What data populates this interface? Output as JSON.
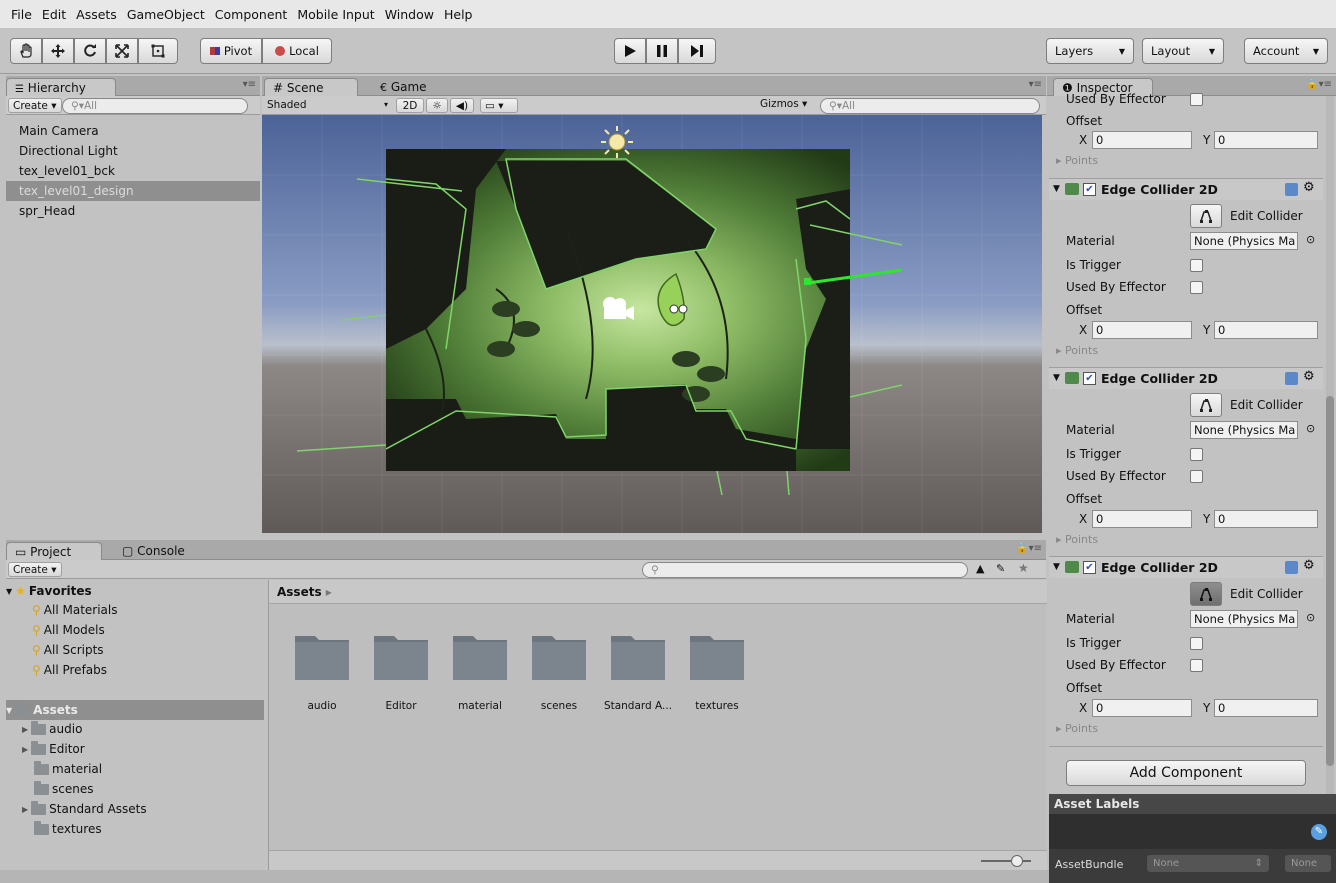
{
  "menu": [
    "File",
    "Edit",
    "Assets",
    "GameObject",
    "Component",
    "Mobile Input",
    "Window",
    "Help"
  ],
  "toolbar": {
    "pivot": "Pivot",
    "local": "Local",
    "layers": "Layers",
    "layout": "Layout",
    "account": "Account"
  },
  "hierarchy": {
    "tab": "Hierarchy",
    "create": "Create",
    "search_placeholder": "All",
    "items": [
      "Main Camera",
      "Directional Light",
      "tex_level01_bck",
      "tex_level01_design",
      "spr_Head"
    ],
    "selected_index": 3
  },
  "scene": {
    "tab_scene": "Scene",
    "tab_game": "Game",
    "shading": "Shaded",
    "mode_2d": "2D",
    "gizmos": "Gizmos",
    "search_placeholder": "All"
  },
  "inspector": {
    "tab": "Inspector",
    "top_used_by_effector": "Used By Effector",
    "top_offset": "Offset",
    "top_x": "0",
    "top_y": "0",
    "top_points": "Points",
    "components": [
      {
        "title": "Edge Collider 2D",
        "edit": "Edit Collider",
        "material_label": "Material",
        "material_value": "None (Physics Ma",
        "trigger": "Is Trigger",
        "effector": "Used By Effector",
        "offset": "Offset",
        "x": "0",
        "y": "0",
        "points": "Points"
      },
      {
        "title": "Edge Collider 2D",
        "edit": "Edit Collider",
        "material_label": "Material",
        "material_value": "None (Physics Ma",
        "trigger": "Is Trigger",
        "effector": "Used By Effector",
        "offset": "Offset",
        "x": "0",
        "y": "0",
        "points": "Points"
      },
      {
        "title": "Edge Collider 2D",
        "edit": "Edit Collider",
        "material_label": "Material",
        "material_value": "None (Physics Ma",
        "trigger": "Is Trigger",
        "effector": "Used By Effector",
        "offset": "Offset",
        "x": "0",
        "y": "0",
        "points": "Points"
      }
    ],
    "add_component": "Add Component",
    "asset_labels": "Asset Labels",
    "asset_bundle": "AssetBundle",
    "bundle_value": "None",
    "bundle_variant": "None"
  },
  "project": {
    "tab_project": "Project",
    "tab_console": "Console",
    "create": "Create",
    "favorites": "Favorites",
    "fav_items": [
      "All Materials",
      "All Models",
      "All Scripts",
      "All Prefabs"
    ],
    "assets_root": "Assets",
    "asset_tree": [
      "audio",
      "Editor",
      "material",
      "scenes",
      "Standard Assets",
      "textures"
    ],
    "breadcrumb": "Assets",
    "folders": [
      "audio",
      "Editor",
      "material",
      "scenes",
      "Standard A...",
      "textures"
    ]
  }
}
